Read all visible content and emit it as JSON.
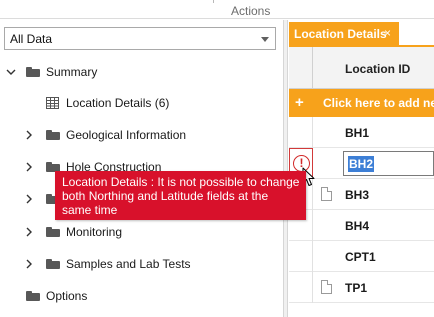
{
  "ribbon": {
    "group_label": "Actions"
  },
  "filter": {
    "selected": "All Data"
  },
  "tree": {
    "summary": "Summary",
    "location_details": "Location Details (6)",
    "geological_information": "Geological Information",
    "hole_construction": "Hole Construction",
    "hidden_item": "",
    "monitoring": "Monitoring",
    "samples_lab_tests": "Samples and Lab Tests",
    "options": "Options"
  },
  "tab": {
    "title": "Location Details",
    "close_glyph": "×"
  },
  "grid": {
    "column_header": "Location ID",
    "add_row_text": "Click here to add new",
    "add_row_glyph": "+",
    "rows": [
      {
        "id": "BH1",
        "has_doc": false,
        "editing": false,
        "error": false
      },
      {
        "id": "BH2",
        "has_doc": false,
        "editing": true,
        "error": true
      },
      {
        "id": "BH3",
        "has_doc": true,
        "editing": false,
        "error": false
      },
      {
        "id": "BH4",
        "has_doc": false,
        "editing": false,
        "error": false
      },
      {
        "id": "CPT1",
        "has_doc": false,
        "editing": false,
        "error": false
      },
      {
        "id": "TP1",
        "has_doc": true,
        "editing": false,
        "error": false
      }
    ],
    "error_glyph": "!"
  },
  "error_tooltip": {
    "message": "Location Details : It is not possible to change both Northing and Latitude fields at the same time"
  },
  "colors": {
    "accent": "#f7a21b",
    "error": "#d8112b",
    "selection": "#3d7fd6"
  }
}
